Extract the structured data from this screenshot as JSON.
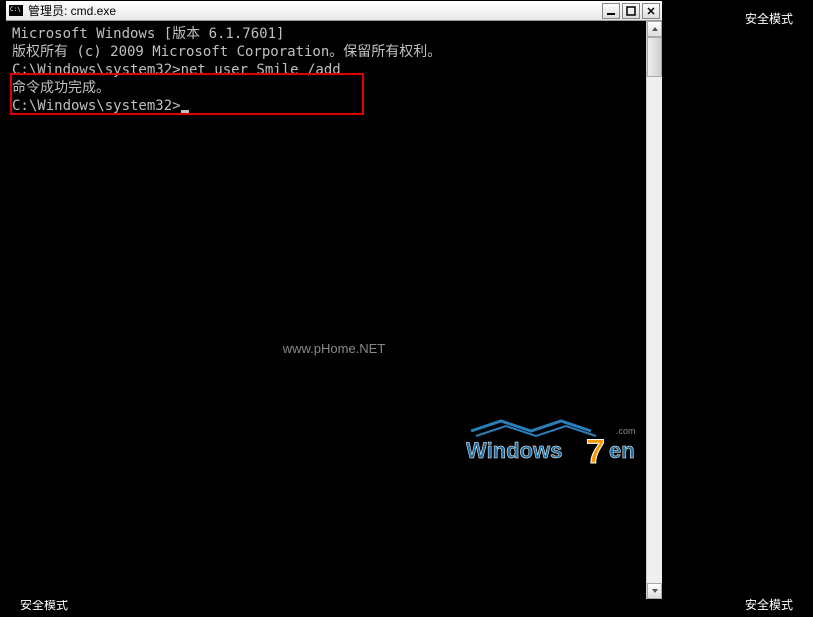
{
  "desktop": {
    "safemode_tr": "安全模式",
    "safemode_bl": "安全模式",
    "safemode_br": "安全模式"
  },
  "window": {
    "title": "管理员: cmd.exe"
  },
  "terminal": {
    "line1": "Microsoft Windows [版本 6.1.7601]",
    "line2": "版权所有 (c) 2009 Microsoft Corporation。保留所有权利。",
    "blank1": "",
    "prompt1": "C:\\Windows\\system32>net user Smile /add",
    "result1": "命令成功完成。",
    "blank2": "",
    "blank3": "",
    "prompt2": "C:\\Windows\\system32>"
  },
  "watermark": {
    "text": "www.pHome.NET"
  },
  "logo": {
    "text1": "Windows",
    "text2": "7",
    "text3": "en",
    "domain": ".com"
  }
}
